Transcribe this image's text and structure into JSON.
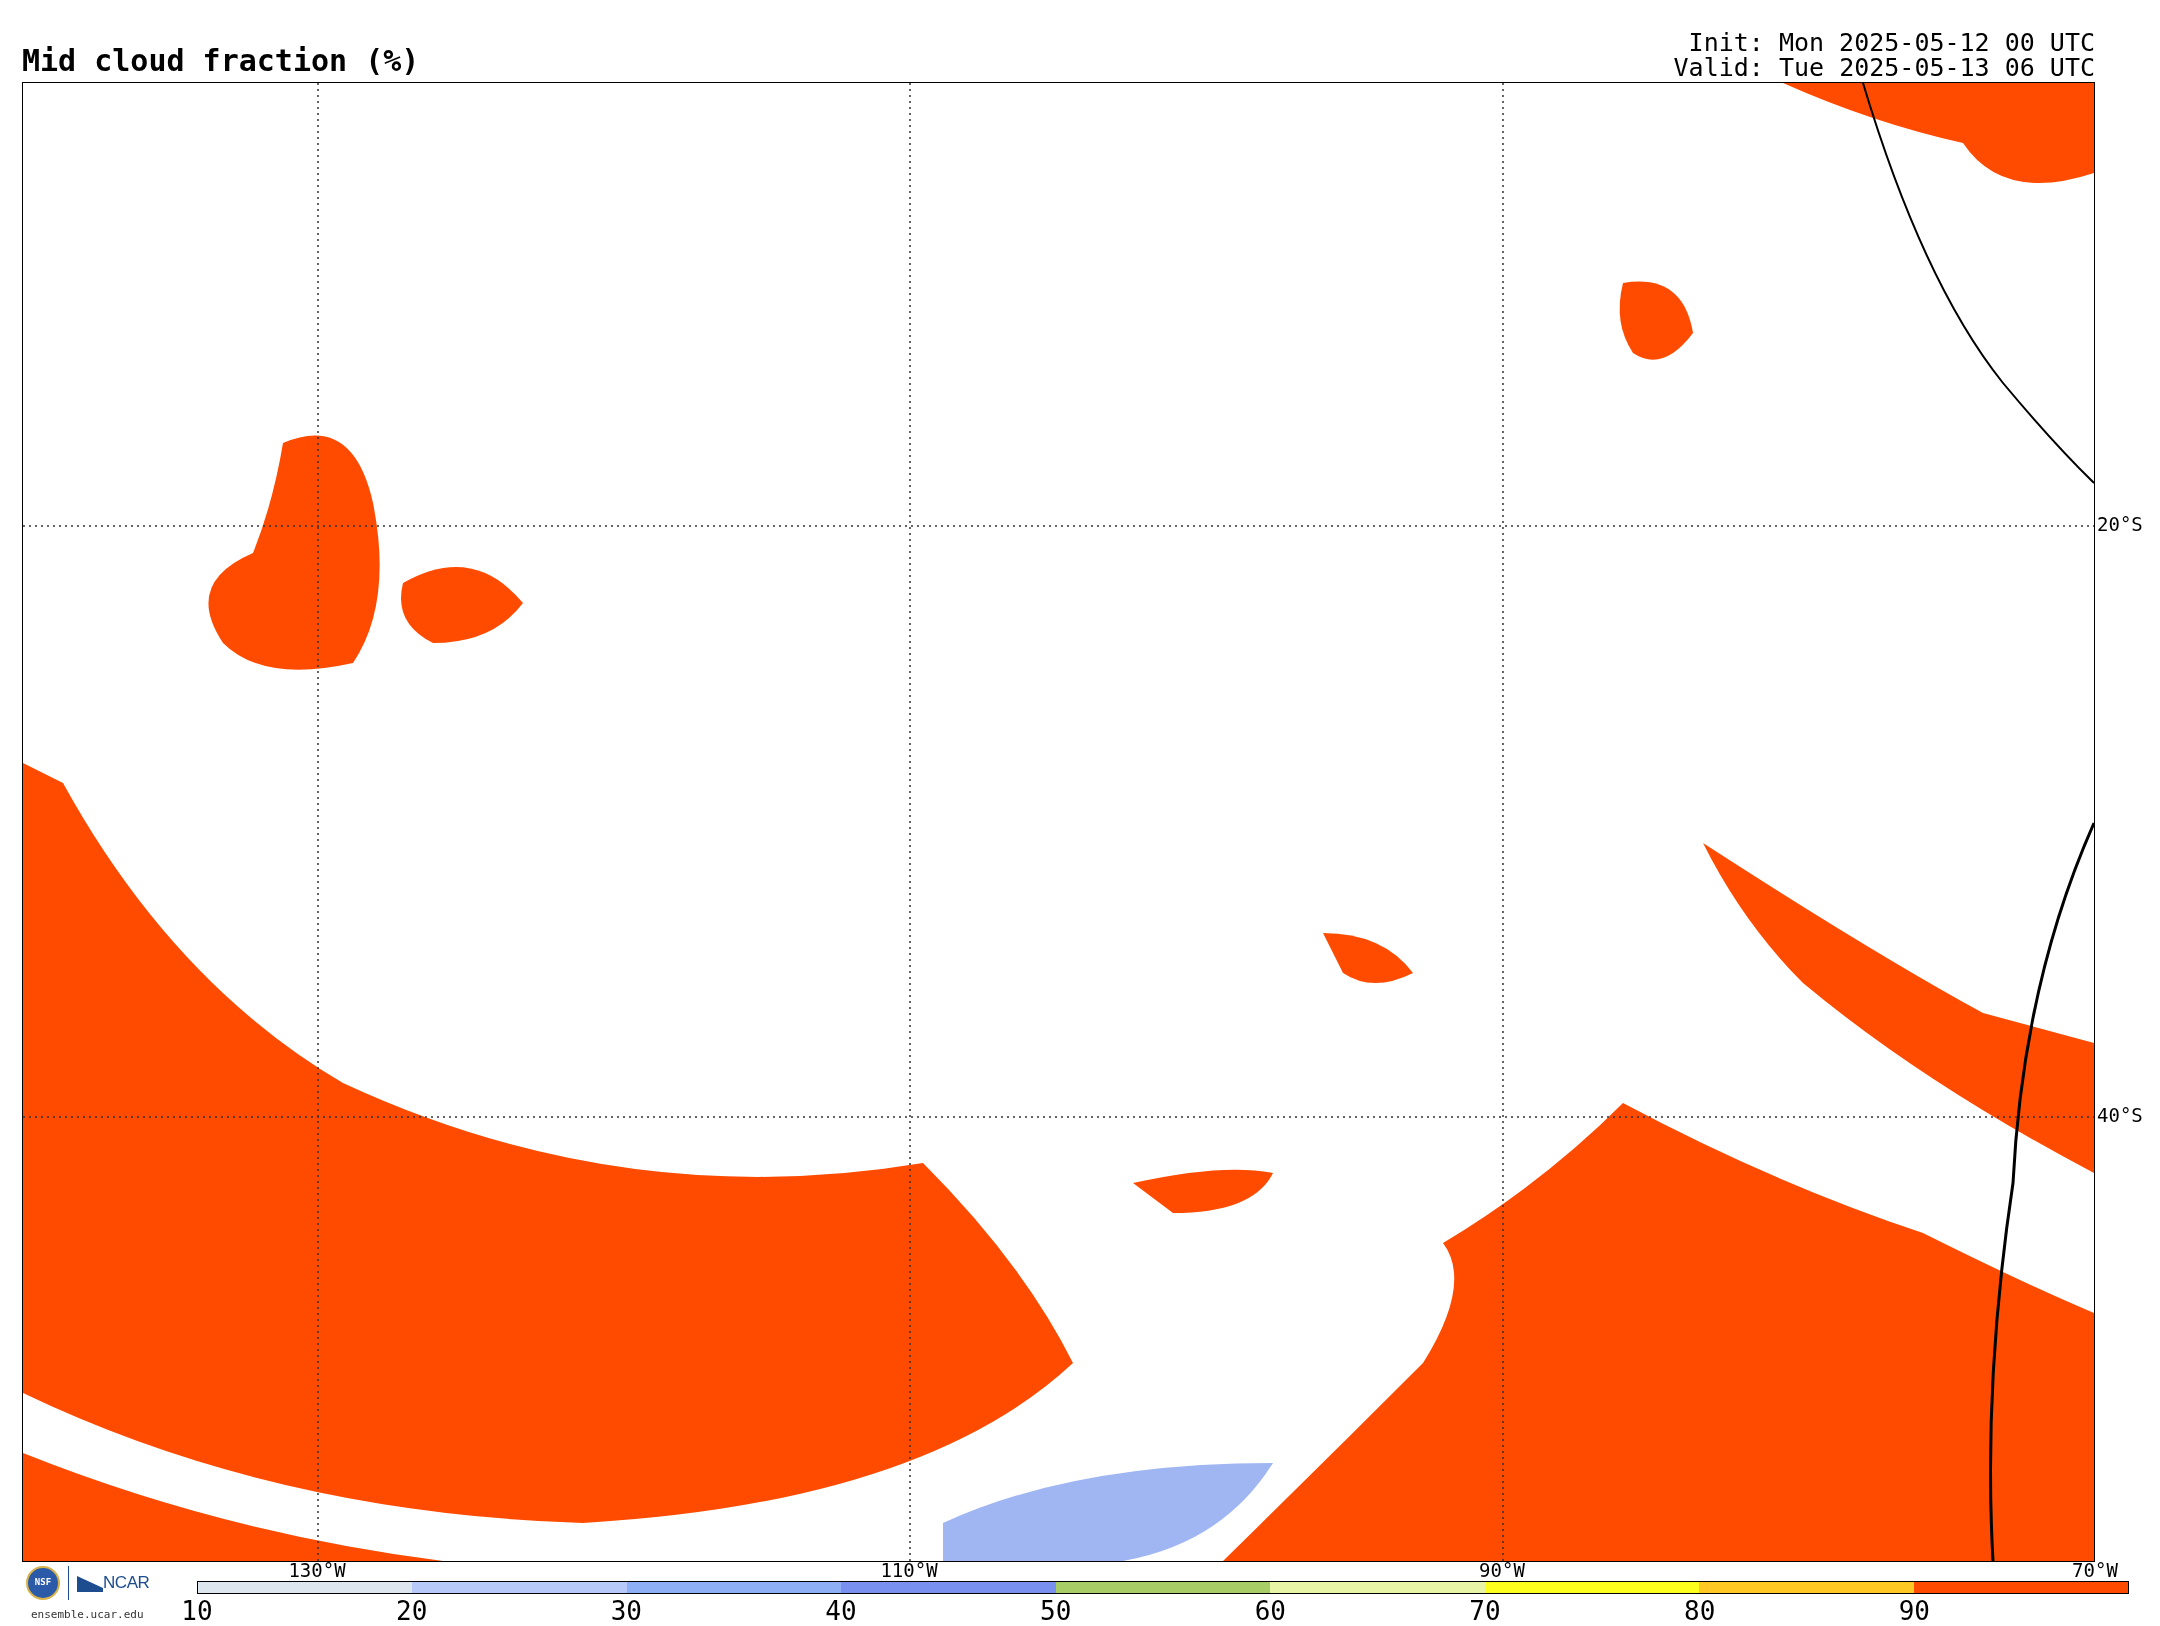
{
  "title": "Mid cloud fraction (%)",
  "init": "Init: Mon 2025-05-12 00 UTC",
  "valid": "Valid: Tue 2025-05-13 06 UTC",
  "map": {
    "lat_labels": [
      "20°S",
      "40°S"
    ],
    "lon_labels": [
      "130°W",
      "110°W",
      "90°W",
      "70°W"
    ]
  },
  "logos": {
    "nsf": "NSF",
    "ncar": "NCAR",
    "site": "ensemble.ucar.edu"
  },
  "colorbar": {
    "segments": [
      {
        "color": "#dde5ee"
      },
      {
        "color": "#b6c9f8"
      },
      {
        "color": "#8eaef6"
      },
      {
        "color": "#7a90f0"
      },
      {
        "color": "#a9cd66"
      },
      {
        "color": "#e8f5a6"
      },
      {
        "color": "#ffff1e"
      },
      {
        "color": "#ffc822"
      },
      {
        "color": "#ff4b00"
      }
    ],
    "ticks": [
      "10",
      "20",
      "30",
      "40",
      "50",
      "60",
      "70",
      "80",
      "90"
    ]
  }
}
